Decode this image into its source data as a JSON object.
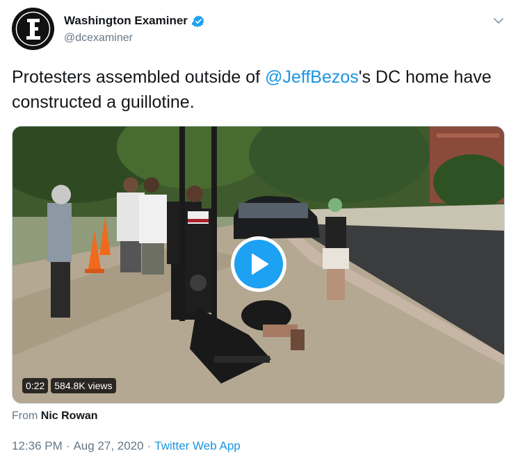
{
  "author": {
    "display_name": "Washington Examiner",
    "handle": "@dcexaminer",
    "verified": true
  },
  "tweet": {
    "text_before": "Protesters assembled outside of ",
    "mention": "@JeffBezos",
    "text_after": "'s DC home have constructed a guillotine."
  },
  "video": {
    "duration": "0:22",
    "views": "584.8K views"
  },
  "attribution": {
    "prefix": "From",
    "name": "Nic Rowan"
  },
  "meta": {
    "time": "12:36 PM",
    "separator": "·",
    "date": "Aug 27, 2020",
    "source": "Twitter Web App"
  },
  "colors": {
    "accent": "#1da1f2",
    "link": "#1b95e0",
    "secondary_text": "#657786",
    "primary_text": "#14171a"
  }
}
